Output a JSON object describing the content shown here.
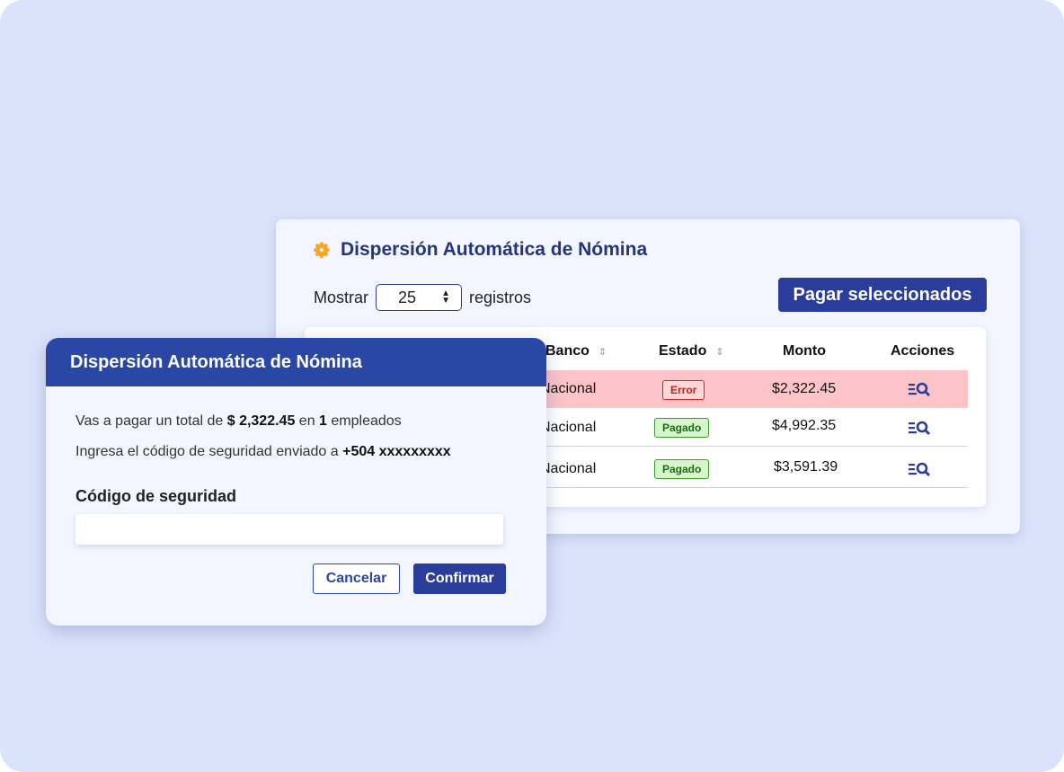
{
  "back_card": {
    "title": "Dispersión Automática de Nómina",
    "show_label": "Mostrar",
    "show_value": "25",
    "records_label": "registros",
    "pay_selected_label": "Pagar seleccionados",
    "columns": [
      "Banco",
      "Estado",
      "Monto",
      "Acciones"
    ],
    "rows": [
      {
        "bank": "Nacional",
        "status": "Error",
        "status_kind": "error",
        "amount": "$2,322.45"
      },
      {
        "bank": "Nacional",
        "status": "Pagado",
        "status_kind": "ok",
        "amount": "$4,992.35"
      },
      {
        "bank": "Nacional",
        "status": "Pagado",
        "status_kind": "ok",
        "amount": "$3,591.39"
      }
    ],
    "action_icon": "list-search-icon"
  },
  "modal": {
    "title": "Dispersión Automática de Nómina",
    "line1_prefix": "Vas a pagar un total de ",
    "line1_amount": "$ 2,322.45",
    "line1_mid": " en ",
    "line1_count": "1",
    "line1_suffix": " empleados",
    "line2_prefix": "Ingresa el código de seguridad enviado a ",
    "line2_phone": "+504 xxxxxxxxx",
    "field_label": "Código de seguridad",
    "field_value": "",
    "cancel_label": "Cancelar",
    "confirm_label": "Confirmar"
  },
  "colors": {
    "background": "#dbe3fb",
    "primary": "#2a3d9a",
    "header": "#2b47a6",
    "gear": "#f5a623",
    "error_row": "#fcc4c9"
  }
}
